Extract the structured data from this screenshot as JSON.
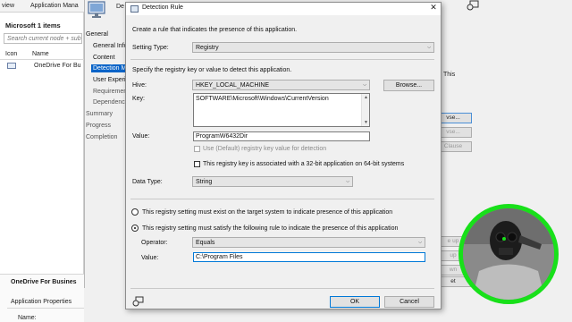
{
  "console": {
    "breadcrumb_left": "view",
    "breadcrumb_app": "Application Mana",
    "breadcrumb_sep": ">",
    "pane_title": "Microsoft 1 items",
    "search_placeholder": "Search current node + sub",
    "columns": [
      "Icon",
      "Name"
    ],
    "row_name": "OneDrive For Bu",
    "bottom_app_name": "OneDrive For Busines",
    "bottom_props": "Application Properties",
    "bottom_name_label": "Name:"
  },
  "wizard": {
    "title": "De",
    "nav": {
      "general": "General",
      "general_info": "General Info",
      "content": "Content",
      "detection": "Detection M",
      "user_exp": "User Experie",
      "requirements": "Requiremer",
      "dependencies": "Dependenc",
      "summary": "Summary",
      "progress": "Progress",
      "completion": "Completion"
    },
    "hint": "This",
    "bg_buttons": [
      "vse...",
      "vse...",
      "Clause",
      "e up",
      "up",
      "wn",
      "et"
    ]
  },
  "dialog": {
    "title": "Detection Rule",
    "close": "✕",
    "intro": "Create a rule that indicates the presence of this application.",
    "setting_type_label": "Setting Type:",
    "setting_type_value": "Registry",
    "specify_text": "Specify the registry key or value to detect this application.",
    "hive_label": "Hive:",
    "hive_value": "HKEY_LOCAL_MACHINE",
    "browse_label": "Browse...",
    "key_label": "Key:",
    "key_value": "SOFTWARE\\Microsoft\\Windows\\CurrentVersion",
    "value_label": "Value:",
    "value_value": "ProgramW6432Dir",
    "use_default_text": "Use (Default) registry key value for detection",
    "use_default_checked": false,
    "is32bit_text": "This registry key is associated with a 32-bit application on 64-bit systems",
    "is32bit_checked": false,
    "data_type_label": "Data Type:",
    "data_type_value": "String",
    "radio_exist_text": "This registry setting must exist on the target system to indicate presence of this application",
    "radio_rule_text": "This registry setting must satisfy the following rule to indicate the presence of this application",
    "selected_radio": "rule",
    "operator_label": "Operator:",
    "operator_value": "Equals",
    "rule_value_label": "Value:",
    "rule_value_value": "C:\\Program Files",
    "ok_label": "OK",
    "cancel_label": "Cancel"
  },
  "colors": {
    "accent": "#0078d7",
    "nav_selected": "#0a64c8",
    "webcam_ring": "#18e01a"
  },
  "icons": {
    "wizard": "computer-monitor-icon",
    "dialog": "window-icon",
    "help": "feedback-smile-icon"
  }
}
